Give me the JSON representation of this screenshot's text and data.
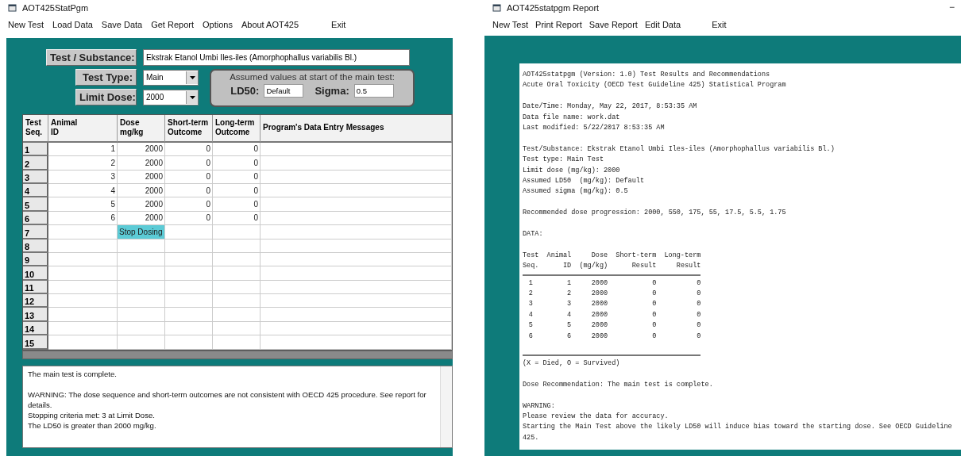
{
  "main_window": {
    "title": "AOT425StatPgm",
    "menu": [
      "New Test",
      "Load Data",
      "Save Data",
      "Get Report",
      "Options",
      "About AOT425",
      "Exit"
    ],
    "substance": {
      "label": "Test / Substance:",
      "value": "Ekstrak Etanol Umbi Iles-iles (Amorphophallus variabilis Bl.)"
    },
    "test_type": {
      "label": "Test Type:",
      "value": "Main"
    },
    "limit_dose": {
      "label": "Limit Dose:",
      "value": "2000"
    },
    "assumed": {
      "title": "Assumed values at start of the main test:",
      "ld50_label": "LD50:",
      "ld50_value": "Default",
      "sigma_label": "Sigma:",
      "sigma_value": "0.5"
    },
    "table": {
      "columns": [
        [
          "Test",
          "Seq."
        ],
        [
          "Animal",
          "ID"
        ],
        [
          "Dose",
          "mg/kg"
        ],
        [
          "Short-term",
          "Outcome"
        ],
        [
          "Long-term",
          "Outcome"
        ],
        [
          "Program's Data Entry Messages"
        ]
      ],
      "rows": [
        {
          "seq": "1",
          "animal_id": "1",
          "dose": "2000",
          "short_term": "0",
          "long_term": "0",
          "dose_highlight": false
        },
        {
          "seq": "2",
          "animal_id": "2",
          "dose": "2000",
          "short_term": "0",
          "long_term": "0",
          "dose_highlight": false
        },
        {
          "seq": "3",
          "animal_id": "3",
          "dose": "2000",
          "short_term": "0",
          "long_term": "0",
          "dose_highlight": false
        },
        {
          "seq": "4",
          "animal_id": "4",
          "dose": "2000",
          "short_term": "0",
          "long_term": "0",
          "dose_highlight": false
        },
        {
          "seq": "5",
          "animal_id": "5",
          "dose": "2000",
          "short_term": "0",
          "long_term": "0",
          "dose_highlight": false
        },
        {
          "seq": "6",
          "animal_id": "6",
          "dose": "2000",
          "short_term": "0",
          "long_term": "0",
          "dose_highlight": false
        },
        {
          "seq": "7",
          "dose": "Stop Dosing",
          "dose_highlight": true
        },
        {
          "seq": "8",
          "dose_highlight": false
        },
        {
          "seq": "9",
          "dose_highlight": false
        },
        {
          "seq": "10",
          "dose_highlight": false
        },
        {
          "seq": "11",
          "dose_highlight": false
        },
        {
          "seq": "12",
          "dose_highlight": false
        },
        {
          "seq": "13",
          "dose_highlight": false
        },
        {
          "seq": "14",
          "dose_highlight": false
        },
        {
          "seq": "15",
          "dose_highlight": false
        }
      ]
    },
    "messages": [
      "The main test is complete.",
      "WARNING: The dose sequence and short-term outcomes are not consistent with OECD 425 procedure. See report for details.",
      "Stopping criteria met: 3 at Limit Dose.",
      "The LD50 is greater than 2000 mg/kg."
    ]
  },
  "report_window": {
    "title": "AOT425statpgm Report",
    "menu": [
      "New Test",
      "Print Report",
      "Save Report",
      "Edit Data",
      "Exit"
    ],
    "report": [
      {
        "kind": "line",
        "text": "AOT425statpgm (Version: 1.0) Test Results and Recommendations"
      },
      {
        "kind": "line",
        "text": "Acute Oral Toxicity (OECD Test Guideline 425) Statistical Program"
      },
      {
        "kind": "gap"
      },
      {
        "kind": "line",
        "text": "Date/Time: Monday, May 22, 2017, 8:53:35 AM"
      },
      {
        "kind": "line",
        "text": "Data file name: work.dat"
      },
      {
        "kind": "line",
        "text": "Last modified: 5/22/2017 8:53:35 AM"
      },
      {
        "kind": "gap"
      },
      {
        "kind": "line",
        "text": "Test/Substance: Ekstrak Etanol Umbi Iles-iles (Amorphophallus variabilis Bl.)"
      },
      {
        "kind": "line",
        "text": "Test type: Main Test"
      },
      {
        "kind": "line",
        "text": "Limit dose (mg/kg): 2000"
      },
      {
        "kind": "line",
        "text": "Assumed LD50  (mg/kg): Default"
      },
      {
        "kind": "line",
        "text": "Assumed sigma (mg/kg): 0.5"
      },
      {
        "kind": "gap"
      },
      {
        "kind": "line",
        "text": "Recommended dose progression: 2000, 550, 175, 55, 17.5, 5.5, 1.75"
      },
      {
        "kind": "gap"
      },
      {
        "kind": "line",
        "text": "DATA:"
      },
      {
        "kind": "gap"
      },
      {
        "kind": "table",
        "header": [
          [
            "Test",
            "Animal",
            "Dose",
            "Short-term",
            "Long-term"
          ],
          [
            "Seq.",
            "ID",
            "(mg/kg)",
            "Result",
            "Result"
          ]
        ],
        "rows": [
          [
            "1",
            "1",
            "2000",
            "0",
            "0"
          ],
          [
            "2",
            "2",
            "2000",
            "0",
            "0"
          ],
          [
            "3",
            "3",
            "2000",
            "0",
            "0"
          ],
          [
            "4",
            "4",
            "2000",
            "0",
            "0"
          ],
          [
            "5",
            "5",
            "2000",
            "0",
            "0"
          ],
          [
            "6",
            "6",
            "2000",
            "0",
            "0"
          ]
        ]
      },
      {
        "kind": "line",
        "text": "(X = Died, O = Survived)"
      },
      {
        "kind": "gap"
      },
      {
        "kind": "line",
        "text": "Dose Recommendation: The main test is complete."
      },
      {
        "kind": "gap"
      },
      {
        "kind": "line",
        "text": "WARNING:"
      },
      {
        "kind": "line",
        "text": "Please review the data for accuracy."
      },
      {
        "kind": "line",
        "text": "Starting the Main Test above the likely LD50 will induce bias toward the starting dose. See OECD Guideline"
      },
      {
        "kind": "line",
        "text": "425."
      }
    ],
    "minimize": "−"
  }
}
